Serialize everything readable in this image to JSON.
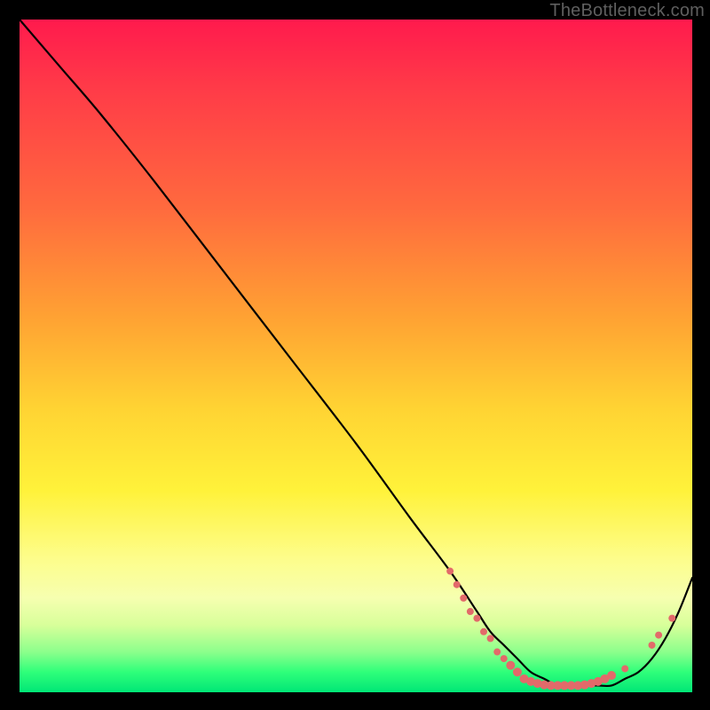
{
  "watermark": "TheBottleneck.com",
  "chart_data": {
    "type": "line",
    "title": "",
    "xlabel": "",
    "ylabel": "",
    "xlim": [
      0,
      100
    ],
    "ylim": [
      0,
      100
    ],
    "grid": false,
    "legend": false,
    "series": [
      {
        "name": "curve",
        "x": [
          0,
          6,
          12,
          20,
          30,
          40,
          50,
          58,
          64,
          68,
          70,
          72,
          74,
          76,
          78,
          80,
          82,
          84,
          86,
          88,
          90,
          92,
          94,
          96,
          98,
          100
        ],
        "y": [
          100,
          93,
          86,
          76,
          63,
          50,
          37,
          26,
          18,
          12,
          9,
          7,
          5,
          3,
          2,
          1,
          1,
          1,
          1,
          1,
          2,
          3,
          5,
          8,
          12,
          17
        ]
      }
    ],
    "markers": [
      {
        "x": 64,
        "y": 18,
        "r": 4
      },
      {
        "x": 65,
        "y": 16,
        "r": 4
      },
      {
        "x": 66,
        "y": 14,
        "r": 4
      },
      {
        "x": 67,
        "y": 12,
        "r": 4
      },
      {
        "x": 68,
        "y": 11,
        "r": 4
      },
      {
        "x": 69,
        "y": 9,
        "r": 4
      },
      {
        "x": 70,
        "y": 8,
        "r": 4
      },
      {
        "x": 71,
        "y": 6,
        "r": 4
      },
      {
        "x": 72,
        "y": 5,
        "r": 4
      },
      {
        "x": 73,
        "y": 4,
        "r": 5
      },
      {
        "x": 74,
        "y": 3,
        "r": 5
      },
      {
        "x": 75,
        "y": 2,
        "r": 5
      },
      {
        "x": 76,
        "y": 1.6,
        "r": 5
      },
      {
        "x": 77,
        "y": 1.3,
        "r": 5
      },
      {
        "x": 78,
        "y": 1.1,
        "r": 5
      },
      {
        "x": 79,
        "y": 1.0,
        "r": 5
      },
      {
        "x": 80,
        "y": 1.0,
        "r": 5
      },
      {
        "x": 81,
        "y": 1.0,
        "r": 5
      },
      {
        "x": 82,
        "y": 1.0,
        "r": 5
      },
      {
        "x": 83,
        "y": 1.0,
        "r": 5
      },
      {
        "x": 84,
        "y": 1.1,
        "r": 5
      },
      {
        "x": 85,
        "y": 1.3,
        "r": 5
      },
      {
        "x": 86,
        "y": 1.6,
        "r": 5
      },
      {
        "x": 87,
        "y": 2.0,
        "r": 5
      },
      {
        "x": 88,
        "y": 2.5,
        "r": 5
      },
      {
        "x": 90,
        "y": 3.5,
        "r": 4
      },
      {
        "x": 94,
        "y": 7,
        "r": 4
      },
      {
        "x": 95,
        "y": 8.5,
        "r": 4
      },
      {
        "x": 97,
        "y": 11,
        "r": 4
      }
    ],
    "colors": {
      "curve": "#000000",
      "marker": "#e26a6a"
    }
  }
}
